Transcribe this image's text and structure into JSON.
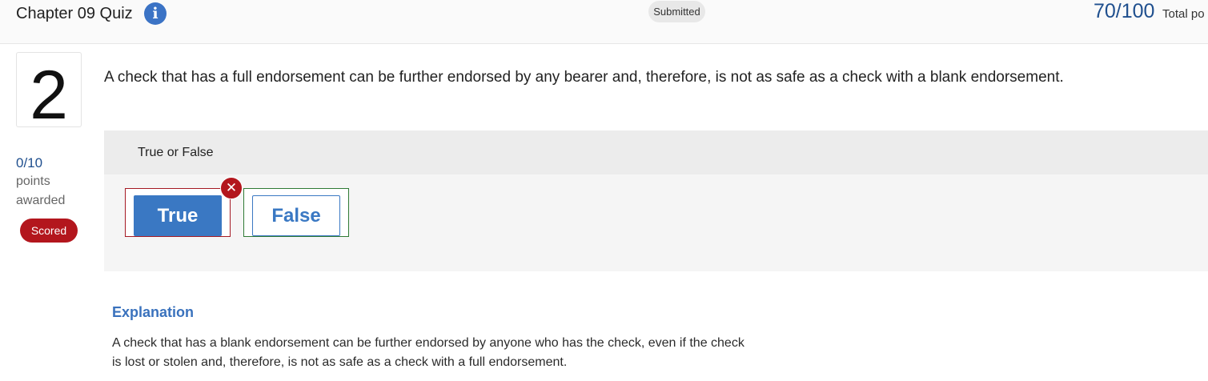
{
  "header": {
    "title": "Chapter 09 Quiz",
    "info_icon": "info-icon",
    "status_badge": "Submitted",
    "score": "70/100",
    "score_label": "Total po"
  },
  "question": {
    "number": "2",
    "text": "A check that has a full endorsement can be further endorsed by any bearer and, therefore, is not as safe as a check with a blank endorsement.",
    "points_value": "0/10",
    "points_label": "points",
    "awarded_label": "awarded",
    "scored_badge": "Scored"
  },
  "answer": {
    "type_label": "True or False",
    "choices": [
      {
        "label": "True",
        "selected": true,
        "status": "incorrect"
      },
      {
        "label": "False",
        "selected": false,
        "status": "correct"
      }
    ],
    "wrong_icon": "x-circle-icon"
  },
  "explanation": {
    "title": "Explanation",
    "line1": "A check that has a blank endorsement can be further endorsed by anyone who has the check, even if the check",
    "line2": "is lost or stolen and, therefore, is not as safe as a check with a full endorsement."
  },
  "colors": {
    "accent": "#3a78c3",
    "score_blue": "#1f4f8e",
    "error_red": "#b3161d",
    "correct_green": "#2f7a35"
  }
}
